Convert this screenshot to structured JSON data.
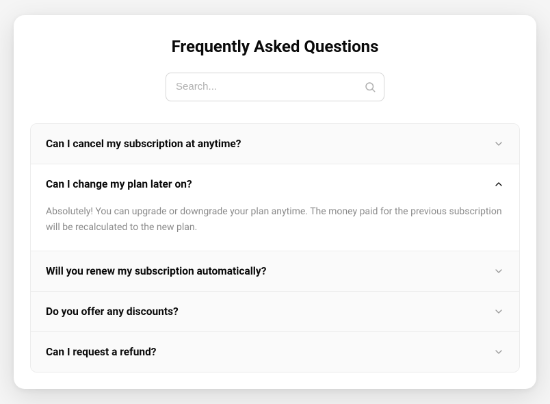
{
  "title": "Frequently Asked Questions",
  "search": {
    "placeholder": "Search..."
  },
  "faq": {
    "items": [
      {
        "question": "Can I cancel my subscription at anytime?",
        "answer": "",
        "expanded": false
      },
      {
        "question": "Can I change my plan later on?",
        "answer": "Absolutely! You can upgrade or downgrade your plan anytime. The money paid for the previous subscription will be recalculated to the new plan.",
        "expanded": true
      },
      {
        "question": "Will you renew my subscription automatically?",
        "answer": "",
        "expanded": false
      },
      {
        "question": "Do you offer any discounts?",
        "answer": "",
        "expanded": false
      },
      {
        "question": "Can I request a refund?",
        "answer": "",
        "expanded": false
      }
    ]
  }
}
